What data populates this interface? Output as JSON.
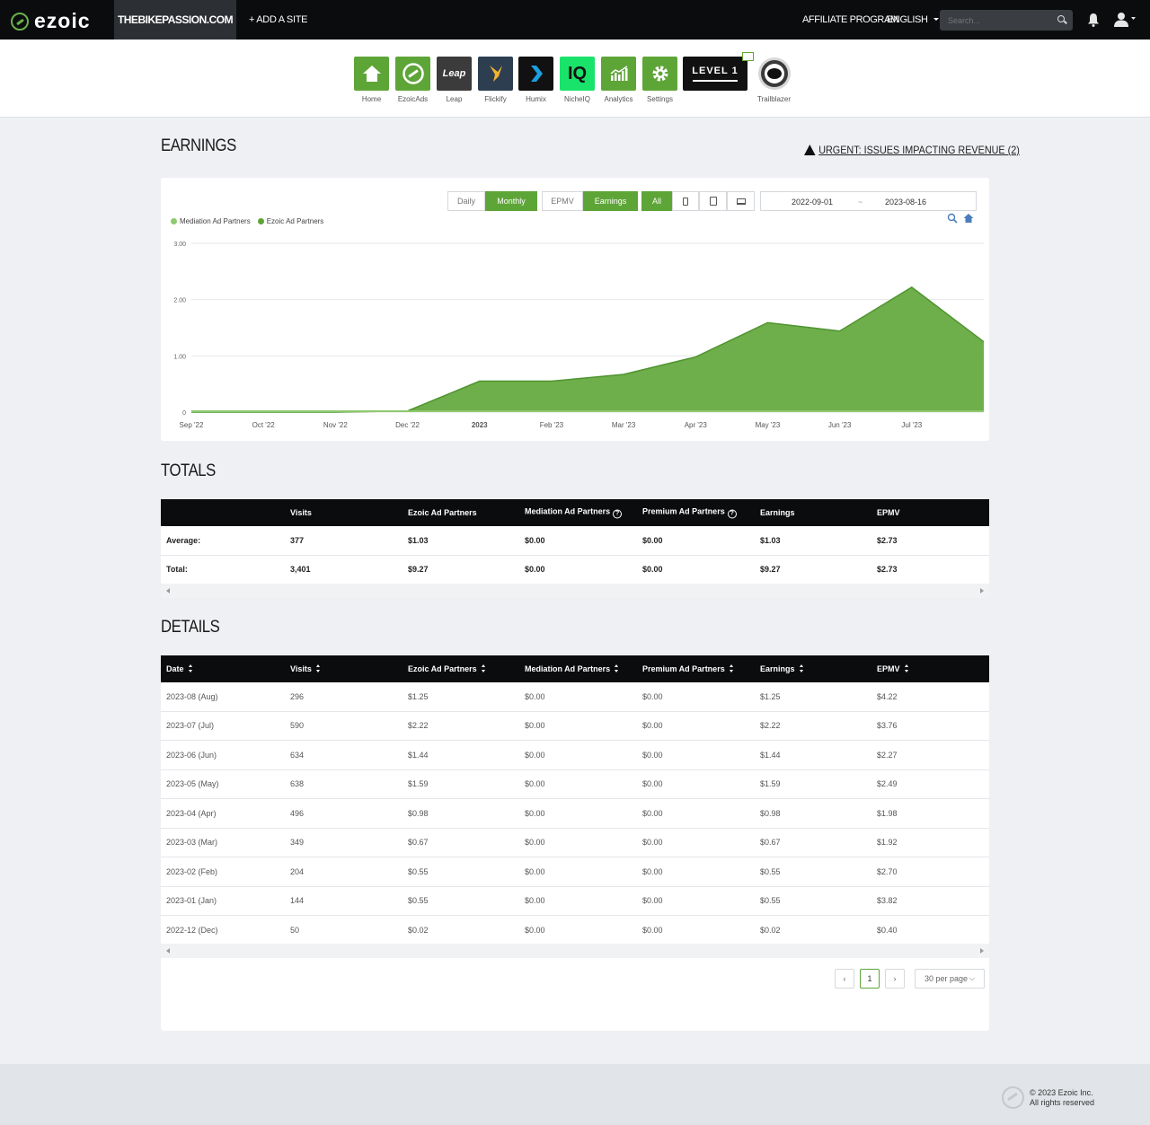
{
  "topbar": {
    "logo": "ezoic",
    "site": "THEBIKEPASSION.COM",
    "add_site": "+ ADD A SITE",
    "affiliate": "AFFILIATE PROGRAM",
    "language": "ENGLISH",
    "search_placeholder": "Search..."
  },
  "apps": [
    {
      "label": "Home",
      "tile": "home",
      "color": "#5ea537"
    },
    {
      "label": "EzoicAds",
      "tile": "ezoic",
      "color": "#5ea537"
    },
    {
      "label": "Leap",
      "tile": "Leap",
      "color": "#3b3b3b"
    },
    {
      "label": "Flickify",
      "tile": "flickify",
      "color": "#2d3e50"
    },
    {
      "label": "Humix",
      "tile": "humix",
      "color": "#111111"
    },
    {
      "label": "NicheIQ",
      "tile": "IQ",
      "color": "#19e36a"
    },
    {
      "label": "Analytics",
      "tile": "analytics",
      "color": "#5ea537"
    },
    {
      "label": "Settings",
      "tile": "settings",
      "color": "#5ea537"
    },
    {
      "label": "",
      "tile": "LEVEL 1",
      "color": "#111111"
    },
    {
      "label": "Trailblazer",
      "tile": "trailblazer",
      "color": "#444444"
    }
  ],
  "earnings": {
    "title": "EARNINGS",
    "urgent": "URGENT: ISSUES IMPACTING REVENUE (2)",
    "buttons": {
      "daily": "Daily",
      "monthly": "Monthly",
      "epmv": "EPMV",
      "earnings": "Earnings",
      "all": "All"
    },
    "date_from": "2022-09-01",
    "date_sep": "~",
    "date_to": "2023-08-16"
  },
  "chart_data": {
    "type": "area",
    "series": [
      {
        "name": "Mediation Ad Partners",
        "color": "#8fc970",
        "values": [
          0,
          0,
          0,
          0,
          0,
          0,
          0,
          0,
          0,
          0,
          0,
          0
        ]
      },
      {
        "name": "Ezoic Ad Partners",
        "color": "#5ea537",
        "values": [
          0,
          0,
          0,
          0.02,
          0.55,
          0.55,
          0.67,
          0.98,
          1.59,
          1.44,
          2.22,
          1.25
        ]
      }
    ],
    "x": [
      "Sep '22",
      "Oct '22",
      "Nov '22",
      "Dec '22",
      "2023",
      "Feb '23",
      "Mar '23",
      "Apr '23",
      "May '23",
      "Jun '23",
      "Jul '23",
      ""
    ],
    "yticks": [
      "0",
      "1.00",
      "2.00",
      "3.00"
    ],
    "ylim": [
      0,
      3
    ],
    "grid": true,
    "legend": "top-left"
  },
  "totals": {
    "title": "TOTALS",
    "headers": [
      "",
      "Visits",
      "Ezoic Ad Partners",
      "Mediation Ad Partners",
      "Premium Ad Partners",
      "Earnings",
      "EPMV"
    ],
    "rows": [
      [
        "Average:",
        "377",
        "$1.03",
        "$0.00",
        "$0.00",
        "$1.03",
        "$2.73"
      ],
      [
        "Total:",
        "3,401",
        "$9.27",
        "$0.00",
        "$0.00",
        "$9.27",
        "$2.73"
      ]
    ]
  },
  "details": {
    "title": "DETAILS",
    "headers": [
      "Date",
      "Visits",
      "Ezoic Ad Partners",
      "Mediation Ad Partners",
      "Premium Ad Partners",
      "Earnings",
      "EPMV"
    ],
    "rows": [
      [
        "2023-08 (Aug)",
        "296",
        "$1.25",
        "$0.00",
        "$0.00",
        "$1.25",
        "$4.22"
      ],
      [
        "2023-07 (Jul)",
        "590",
        "$2.22",
        "$0.00",
        "$0.00",
        "$2.22",
        "$3.76"
      ],
      [
        "2023-06 (Jun)",
        "634",
        "$1.44",
        "$0.00",
        "$0.00",
        "$1.44",
        "$2.27"
      ],
      [
        "2023-05 (May)",
        "638",
        "$1.59",
        "$0.00",
        "$0.00",
        "$1.59",
        "$2.49"
      ],
      [
        "2023-04 (Apr)",
        "496",
        "$0.98",
        "$0.00",
        "$0.00",
        "$0.98",
        "$1.98"
      ],
      [
        "2023-03 (Mar)",
        "349",
        "$0.67",
        "$0.00",
        "$0.00",
        "$0.67",
        "$1.92"
      ],
      [
        "2023-02 (Feb)",
        "204",
        "$0.55",
        "$0.00",
        "$0.00",
        "$0.55",
        "$2.70"
      ],
      [
        "2023-01 (Jan)",
        "144",
        "$0.55",
        "$0.00",
        "$0.00",
        "$0.55",
        "$3.82"
      ],
      [
        "2022-12 (Dec)",
        "50",
        "$0.02",
        "$0.00",
        "$0.00",
        "$0.02",
        "$0.40"
      ]
    ],
    "page": "1",
    "per_page": "30 per page"
  },
  "footer": {
    "line1": "© 2023 Ezoic Inc.",
    "line2": "All rights reserved"
  }
}
